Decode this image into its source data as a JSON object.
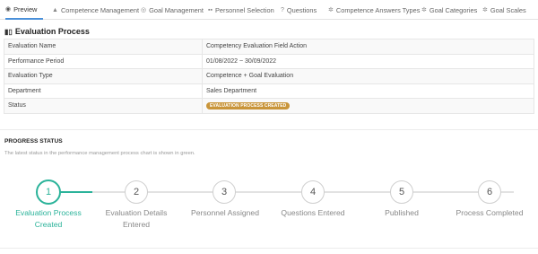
{
  "tabs": [
    {
      "label": "Preview",
      "icon": "eye-icon",
      "active": true
    },
    {
      "label": "Competence Management",
      "icon": "thumbs-up-icon"
    },
    {
      "label": "Goal Management",
      "icon": "target-icon"
    },
    {
      "label": "Personnel Selection",
      "icon": "users-icon"
    },
    {
      "label": "Questions",
      "icon": "question-icon"
    },
    {
      "label": "Competence Answers Types",
      "icon": "gear-icon"
    },
    {
      "label": "Goal Categories",
      "icon": "gear-icon"
    },
    {
      "label": "Goal Scales",
      "icon": "gear-icon"
    }
  ],
  "section": {
    "title": "Evaluation Process",
    "icon": "bar-chart-icon"
  },
  "info": [
    {
      "label": "Evaluation Name",
      "value": "Competency Evaluation Field Action"
    },
    {
      "label": "Performance Period",
      "value": "01/08/2022 ~ 30/09/2022"
    },
    {
      "label": "Evaluation Type",
      "value": "Competence + Goal Evaluation"
    },
    {
      "label": "Department",
      "value": "Sales Department"
    },
    {
      "label": "Status",
      "badge": "EVALUATION PROCESS CREATED"
    }
  ],
  "progress": {
    "title": "PROGRESS STATUS",
    "subtitle": "The latest status in the performance management process chart is shown in green.",
    "steps": [
      {
        "num": "1",
        "line1": "Evaluation Process",
        "line2": "Created",
        "active": true
      },
      {
        "num": "2",
        "line1": "Evaluation Details",
        "line2": "Entered"
      },
      {
        "num": "3",
        "line1": "Personnel Assigned",
        "line2": ""
      },
      {
        "num": "4",
        "line1": "Questions Entered",
        "line2": ""
      },
      {
        "num": "5",
        "line1": "Published",
        "line2": ""
      },
      {
        "num": "6",
        "line1": "Process Completed",
        "line2": ""
      }
    ]
  },
  "colors": {
    "accent": "#2bb39a",
    "badge": "#c9953a",
    "tab_active": "#4a90d9"
  }
}
